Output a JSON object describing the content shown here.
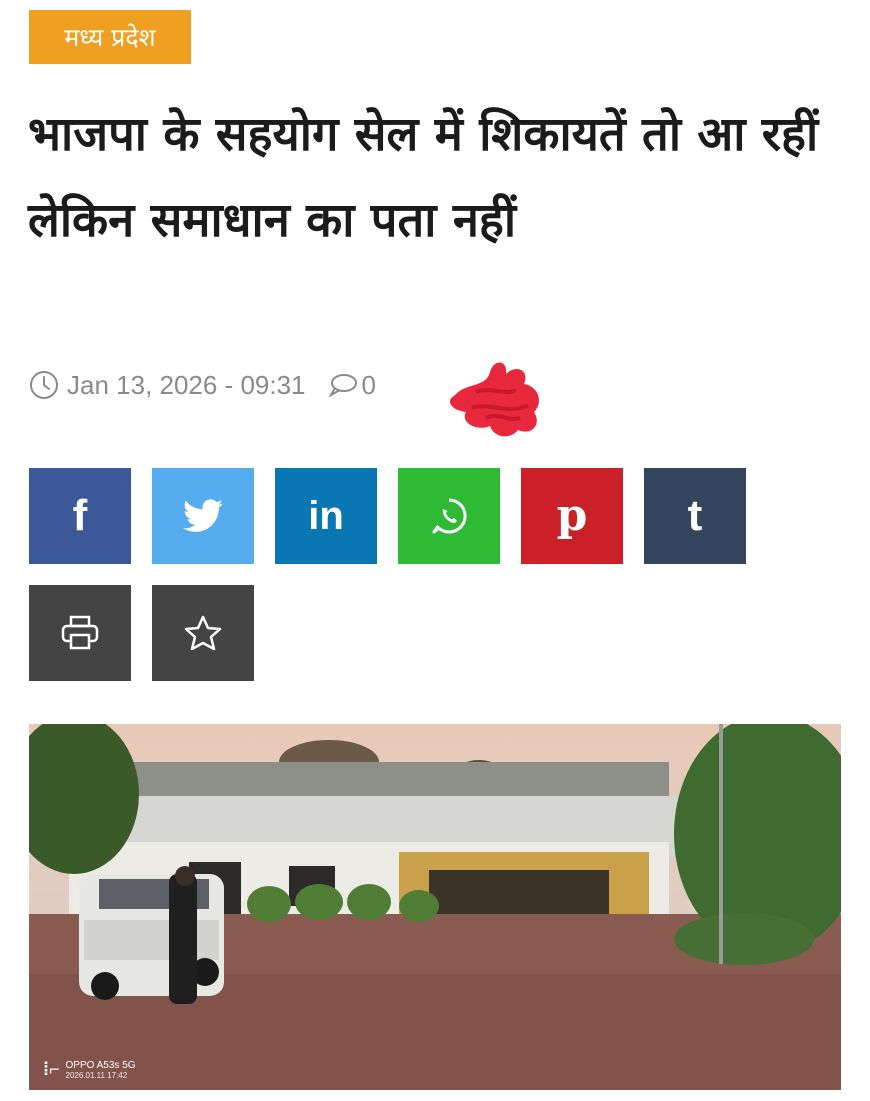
{
  "category": {
    "label": "मध्य प्रदेश"
  },
  "article": {
    "headline": "भाजपा के सहयोग सेल में शिकायतें तो आ रहीं लेकिन समाधान का पता नहीं",
    "date": "Jan 13, 2026 - 09:31",
    "comment_count": "0"
  },
  "share_buttons": [
    {
      "name": "facebook",
      "icon": "facebook-icon",
      "color": "#3b5998"
    },
    {
      "name": "twitter",
      "icon": "twitter-icon",
      "color": "#55acee"
    },
    {
      "name": "linkedin",
      "icon": "linkedin-icon",
      "color": "#0a77b5"
    },
    {
      "name": "whatsapp",
      "icon": "whatsapp-icon",
      "color": "#2fba36"
    },
    {
      "name": "pinterest",
      "icon": "pinterest-icon",
      "color": "#cb2027"
    },
    {
      "name": "tumblr",
      "icon": "tumblr-icon",
      "color": "#34465d"
    },
    {
      "name": "print",
      "icon": "printer-icon",
      "color": "#444444"
    },
    {
      "name": "bookmark",
      "icon": "star-icon",
      "color": "#444444"
    }
  ],
  "photo": {
    "watermark_model": "OPPO A53s 5G",
    "watermark_timestamp": "2026.01.11 17:42"
  },
  "colors": {
    "category_bg": "#f0a020",
    "meta_text": "#8a8a8a",
    "scribble": "#e8283c"
  }
}
